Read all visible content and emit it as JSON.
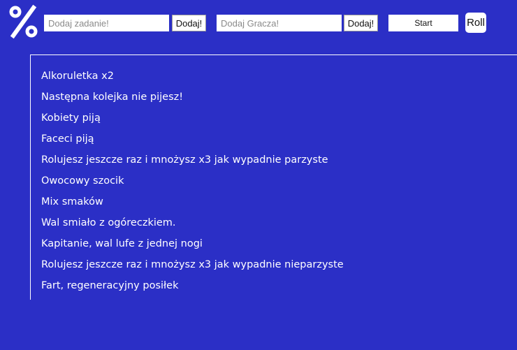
{
  "header": {
    "logo_icon": "percent-icon",
    "task_input": {
      "placeholder": "Dodaj zadanie!",
      "value": ""
    },
    "add_task_label": "Dodaj!",
    "player_input": {
      "placeholder": "Dodaj Gracza!",
      "value": ""
    },
    "add_player_label": "Dodaj!",
    "start_label": "Start",
    "roll_label": "Roll"
  },
  "tasks": [
    "Alkoruletka x2",
    "Następna kolejka nie pijesz!",
    "Kobiety piją",
    "Faceci piją",
    "Rolujesz jeszcze raz i mnożysz x3 jak wypadnie parzyste",
    "Owocowy szocik",
    "Mix smaków",
    "Wal smiało z ogóreczkiem.",
    "Kapitanie, wal lufe z jednej nogi",
    "Rolujesz jeszcze raz i mnożysz x3 jak wypadnie nieparzyste",
    "Fart, regeneracyjny posiłek"
  ],
  "colors": {
    "background": "#2b2fc6",
    "text": "#ffffff",
    "control_bg": "#ffffff"
  }
}
